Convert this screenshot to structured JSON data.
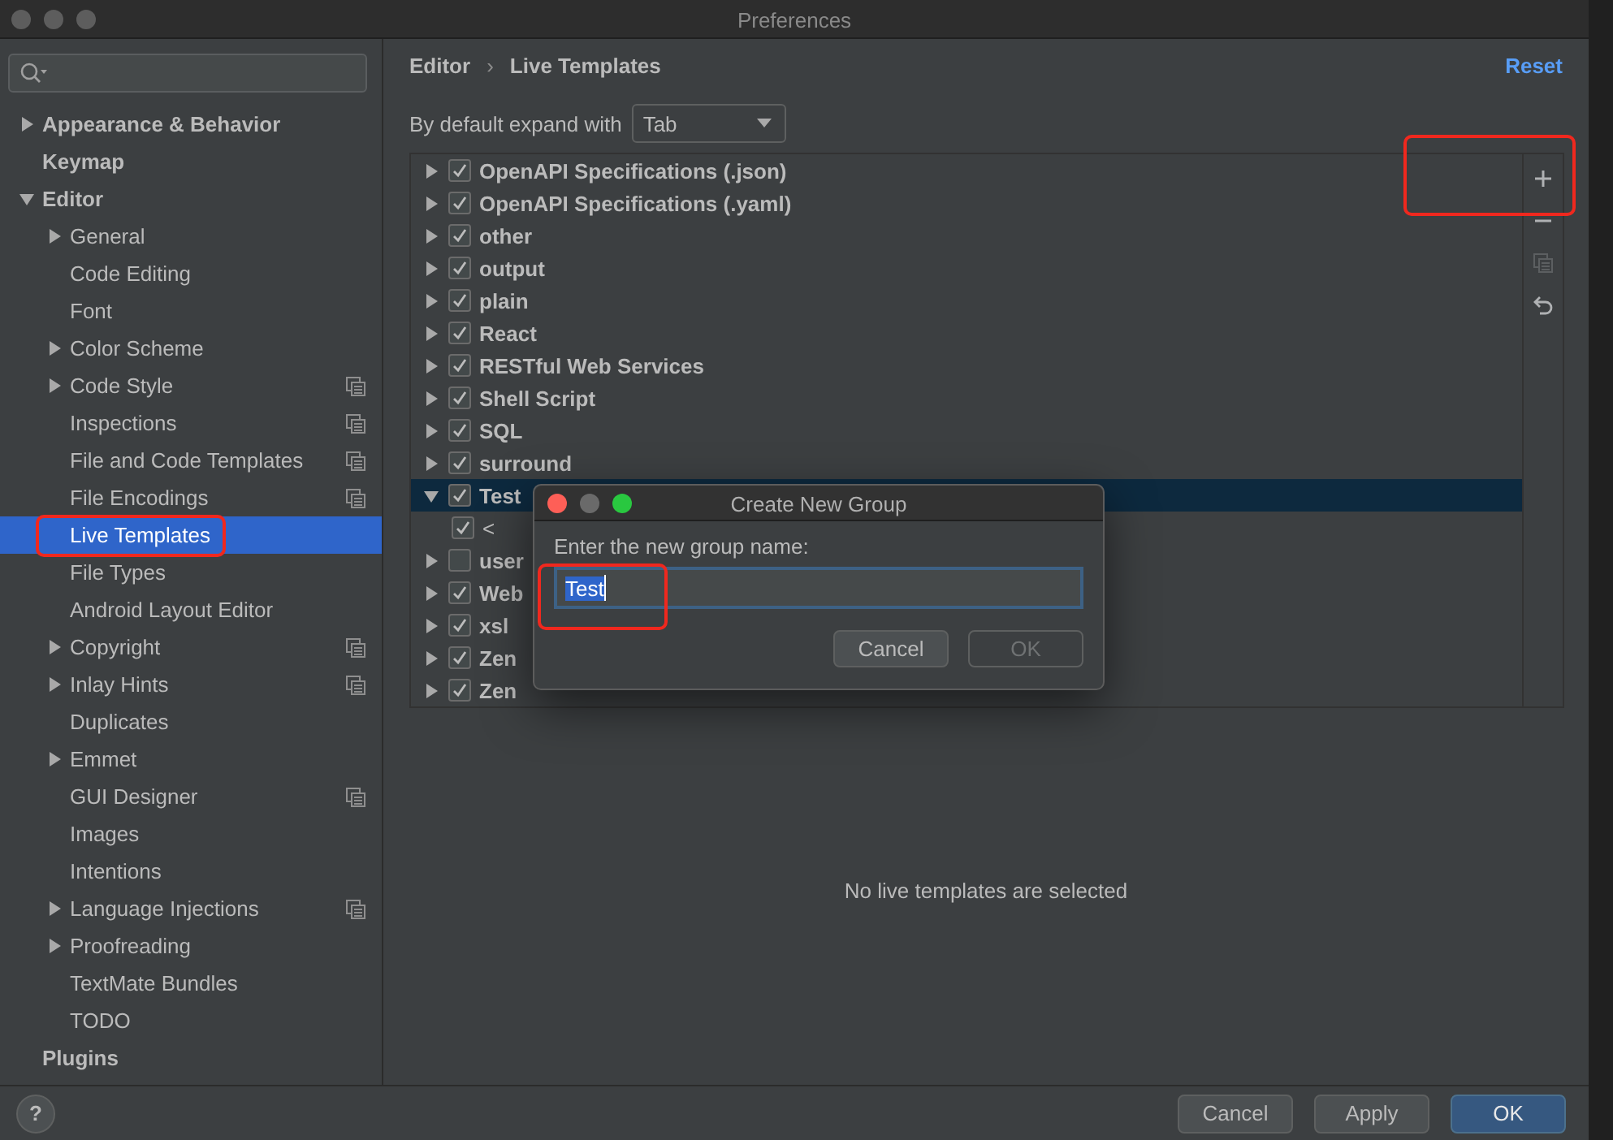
{
  "window": {
    "title": "Preferences",
    "active": false
  },
  "sidebar": {
    "items": [
      {
        "label": "Appearance & Behavior",
        "kind": "group",
        "expanded": false,
        "selected": false,
        "project_scope": false,
        "highlighted": false
      },
      {
        "label": "Keymap",
        "kind": "page",
        "selected": false,
        "project_scope": false,
        "highlighted": false
      },
      {
        "label": "Editor",
        "kind": "group",
        "expanded": true,
        "selected": false,
        "project_scope": false,
        "highlighted": false,
        "children": [
          {
            "label": "General",
            "kind": "group",
            "expanded": false,
            "selected": false,
            "project_scope": false,
            "highlighted": false
          },
          {
            "label": "Code Editing",
            "kind": "page",
            "selected": false,
            "project_scope": false,
            "highlighted": false
          },
          {
            "label": "Font",
            "kind": "page",
            "selected": false,
            "project_scope": false,
            "highlighted": false
          },
          {
            "label": "Color Scheme",
            "kind": "group",
            "expanded": false,
            "selected": false,
            "project_scope": false,
            "highlighted": false
          },
          {
            "label": "Code Style",
            "kind": "group",
            "expanded": false,
            "selected": false,
            "project_scope": true,
            "highlighted": false
          },
          {
            "label": "Inspections",
            "kind": "page",
            "selected": false,
            "project_scope": true,
            "highlighted": false
          },
          {
            "label": "File and Code Templates",
            "kind": "page",
            "selected": false,
            "project_scope": true,
            "highlighted": false
          },
          {
            "label": "File Encodings",
            "kind": "page",
            "selected": false,
            "project_scope": true,
            "highlighted": false
          },
          {
            "label": "Live Templates",
            "kind": "page",
            "selected": true,
            "project_scope": false,
            "highlighted": true
          },
          {
            "label": "File Types",
            "kind": "page",
            "selected": false,
            "project_scope": false,
            "highlighted": false
          },
          {
            "label": "Android Layout Editor",
            "kind": "page",
            "selected": false,
            "project_scope": false,
            "highlighted": false
          },
          {
            "label": "Copyright",
            "kind": "group",
            "expanded": false,
            "selected": false,
            "project_scope": true,
            "highlighted": false
          },
          {
            "label": "Inlay Hints",
            "kind": "group",
            "expanded": false,
            "selected": false,
            "project_scope": true,
            "highlighted": false
          },
          {
            "label": "Duplicates",
            "kind": "page",
            "selected": false,
            "project_scope": false,
            "highlighted": false
          },
          {
            "label": "Emmet",
            "kind": "group",
            "expanded": false,
            "selected": false,
            "project_scope": false,
            "highlighted": false
          },
          {
            "label": "GUI Designer",
            "kind": "page",
            "selected": false,
            "project_scope": true,
            "highlighted": false
          },
          {
            "label": "Images",
            "kind": "page",
            "selected": false,
            "project_scope": false,
            "highlighted": false
          },
          {
            "label": "Intentions",
            "kind": "page",
            "selected": false,
            "project_scope": false,
            "highlighted": false
          },
          {
            "label": "Language Injections",
            "kind": "group",
            "expanded": false,
            "selected": false,
            "project_scope": true,
            "highlighted": false
          },
          {
            "label": "Proofreading",
            "kind": "group",
            "expanded": false,
            "selected": false,
            "project_scope": false,
            "highlighted": false
          },
          {
            "label": "TextMate Bundles",
            "kind": "page",
            "selected": false,
            "project_scope": false,
            "highlighted": false
          },
          {
            "label": "TODO",
            "kind": "page",
            "selected": false,
            "project_scope": false,
            "highlighted": false
          }
        ]
      },
      {
        "label": "Plugins",
        "kind": "page",
        "selected": false,
        "project_scope": false,
        "highlighted": false
      }
    ]
  },
  "breadcrumb": {
    "items": [
      "Editor",
      "Live Templates"
    ],
    "separator": "›"
  },
  "reset_link": "Reset",
  "expand_with": {
    "label": "By default expand with",
    "value": "Tab"
  },
  "template_tree": {
    "items": [
      {
        "label": "OpenAPI Specifications (.json)",
        "kind": "group",
        "expanded": false,
        "checked": true,
        "selected": false
      },
      {
        "label": "OpenAPI Specifications (.yaml)",
        "kind": "group",
        "expanded": false,
        "checked": true,
        "selected": false
      },
      {
        "label": "other",
        "kind": "group",
        "expanded": false,
        "checked": true,
        "selected": false
      },
      {
        "label": "output",
        "kind": "group",
        "expanded": false,
        "checked": true,
        "selected": false
      },
      {
        "label": "plain",
        "kind": "group",
        "expanded": false,
        "checked": true,
        "selected": false
      },
      {
        "label": "React",
        "kind": "group",
        "expanded": false,
        "checked": true,
        "selected": false
      },
      {
        "label": "RESTful Web Services",
        "kind": "group",
        "expanded": false,
        "checked": true,
        "selected": false
      },
      {
        "label": "Shell Script",
        "kind": "group",
        "expanded": false,
        "checked": true,
        "selected": false
      },
      {
        "label": "SQL",
        "kind": "group",
        "expanded": false,
        "checked": true,
        "selected": false
      },
      {
        "label": "surround",
        "kind": "group",
        "expanded": false,
        "checked": true,
        "selected": false
      },
      {
        "label": "Test",
        "kind": "group",
        "expanded": true,
        "checked": true,
        "selected": true,
        "children": [
          {
            "label": "<",
            "kind": "template",
            "checked": true,
            "selected": false
          }
        ]
      },
      {
        "label": "user",
        "kind": "group",
        "expanded": false,
        "checked": false,
        "selected": false
      },
      {
        "label": "Web",
        "kind": "group",
        "expanded": false,
        "checked": true,
        "selected": false
      },
      {
        "label": "xsl",
        "kind": "group",
        "expanded": false,
        "checked": true,
        "selected": false
      },
      {
        "label": "Zen",
        "kind": "group",
        "expanded": false,
        "checked": true,
        "selected": false
      },
      {
        "label": "Zen",
        "kind": "group",
        "expanded": false,
        "checked": true,
        "selected": false
      }
    ],
    "toolbar": [
      {
        "kind": "add",
        "disabled": false,
        "highlighted": true
      },
      {
        "kind": "remove",
        "disabled": false,
        "highlighted": false
      },
      {
        "kind": "copy",
        "disabled": true,
        "highlighted": false
      },
      {
        "kind": "restore",
        "disabled": false,
        "highlighted": false
      }
    ]
  },
  "empty_message": "No live templates are selected",
  "footer": {
    "help": "?",
    "buttons": [
      {
        "label": "Cancel",
        "kind": "default"
      },
      {
        "label": "Apply",
        "kind": "default"
      },
      {
        "label": "OK",
        "kind": "primary"
      }
    ]
  },
  "dialog": {
    "title": "Create New Group",
    "active": true,
    "prompt": "Enter the new group name:",
    "input": {
      "value": "Test",
      "text_selected": true,
      "highlighted": true
    },
    "buttons": [
      {
        "label": "Cancel",
        "disabled": false
      },
      {
        "label": "OK",
        "disabled": true
      }
    ]
  }
}
